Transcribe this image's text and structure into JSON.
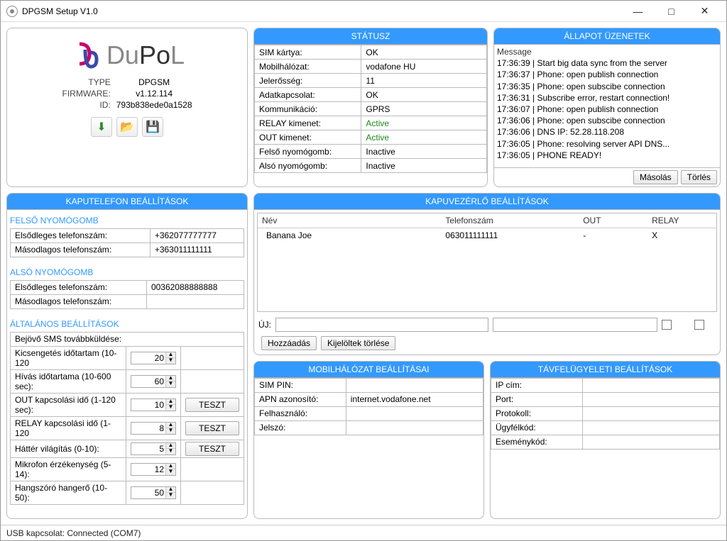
{
  "window": {
    "title": "DPGSM Setup V1.0",
    "minimize": "—",
    "maximize": "□",
    "close": "✕"
  },
  "logo": {
    "text_prefix": "Du",
    "text_mid": "Po",
    "text_suffix": "L",
    "info": {
      "type_lbl": "TYPE",
      "type_val": "DPGSM",
      "fw_lbl": "FIRMWARE:",
      "fw_val": "v1.12.114",
      "id_lbl": "ID:",
      "id_val": "793b838ede0a1528"
    }
  },
  "status": {
    "title": "STÁTUSZ",
    "rows": [
      {
        "k": "SIM kártya:",
        "v": "OK"
      },
      {
        "k": "Mobilhálózat:",
        "v": "vodafone HU"
      },
      {
        "k": "Jelerősség:",
        "v": "11"
      },
      {
        "k": "Adatkapcsolat:",
        "v": "OK"
      },
      {
        "k": "Kommunikáció:",
        "v": "GPRS"
      },
      {
        "k": "RELAY kimenet:",
        "v": "Active",
        "active": true
      },
      {
        "k": "OUT kimenet:",
        "v": "Active",
        "active": true
      },
      {
        "k": "Felső nyomógomb:",
        "v": "Inactive"
      },
      {
        "k": "Alsó nyomógomb:",
        "v": "Inactive"
      }
    ]
  },
  "messages": {
    "title": "ÁLLAPOT ÜZENETEK",
    "header": "Message",
    "lines": [
      "17:36:39 | Start big data sync from the server",
      "17:36:37 | Phone: open publish connection",
      "17:36:35 | Phone: open subscibe connection",
      "17:36:31 | Subscribe error, restart connection!",
      "17:36:07 | Phone: open publish connection",
      "17:36:06 | Phone: open subscibe connection",
      "17:36:06 | DNS IP: 52.28.118.208",
      "17:36:05 | Phone: resolving server API DNS...",
      "17:36:05 | PHONE READY!"
    ],
    "copy_btn": "Másolás",
    "clear_btn": "Törlés"
  },
  "intercom": {
    "title": "KAPUTELEFON BEÁLLÍTÁSOK",
    "upper": {
      "heading": "FELSŐ NYOMÓGOMB",
      "primary_lbl": "Elsődleges telefonszám:",
      "primary_val": "+362077777777",
      "secondary_lbl": "Másodlagos telefonszám:",
      "secondary_val": "+363011111111"
    },
    "lower": {
      "heading": "ALSÓ NYOMÓGOMB",
      "primary_lbl": "Elsődleges telefonszám:",
      "primary_val": "00362088888888",
      "secondary_lbl": "Másodlagos telefonszám:",
      "secondary_val": ""
    },
    "general": {
      "heading": "ÁLTALÁNOS BEÁLLÍTÁSOK",
      "sms_fwd_lbl": "Bejövő SMS továbbküldése:",
      "ring_lbl": "Kicsengetés időtartam (10-120",
      "ring_val": "20",
      "call_lbl": "Hívás időtartama (10-600 sec):",
      "call_val": "60",
      "out_lbl": "OUT kapcsolási idő (1-120 sec):",
      "out_val": "10",
      "relay_lbl": "RELAY kapcsolási idő (1-120",
      "relay_val": "8",
      "light_lbl": "Háttér világítás (0-10):",
      "light_val": "5",
      "mic_lbl": "Mikrofon érzékenység (5-14):",
      "mic_val": "12",
      "spk_lbl": "Hangszóró hangerő (10-50):",
      "spk_val": "50",
      "test_btn": "TESZT"
    }
  },
  "gate": {
    "title": "KAPUVEZÉRLŐ BEÁLLÍTÁSOK",
    "cols": {
      "name": "Név",
      "phone": "Telefonszám",
      "out": "OUT",
      "relay": "RELAY"
    },
    "rows": [
      {
        "name": "Banana Joe",
        "phone": "063011111111",
        "out": "-",
        "relay": "X"
      }
    ],
    "new_lbl": "ÚJ:",
    "add_btn": "Hozzáadás",
    "delsel_btn": "Kijelöltek törlése"
  },
  "mobile": {
    "title": "MOBILHÁLÓZAT BEÁLLÍTÁSAI",
    "rows": [
      {
        "k": "SIM PIN:",
        "v": ""
      },
      {
        "k": "APN azonosító:",
        "v": "internet.vodafone.net"
      },
      {
        "k": "Felhasználó:",
        "v": ""
      },
      {
        "k": "Jelszó:",
        "v": ""
      }
    ]
  },
  "remote": {
    "title": "TÁVFELÜGYELETI BEÁLLÍTÁSOK",
    "rows": [
      {
        "k": "IP cím:",
        "v": ""
      },
      {
        "k": "Port:",
        "v": ""
      },
      {
        "k": "Protokoll:",
        "v": ""
      },
      {
        "k": "Ügyfélkód:",
        "v": ""
      },
      {
        "k": "Eseménykód:",
        "v": ""
      }
    ]
  },
  "statusbar": {
    "usb_lbl": "USB kapcsolat:",
    "usb_val": "Connected (COM7)"
  }
}
